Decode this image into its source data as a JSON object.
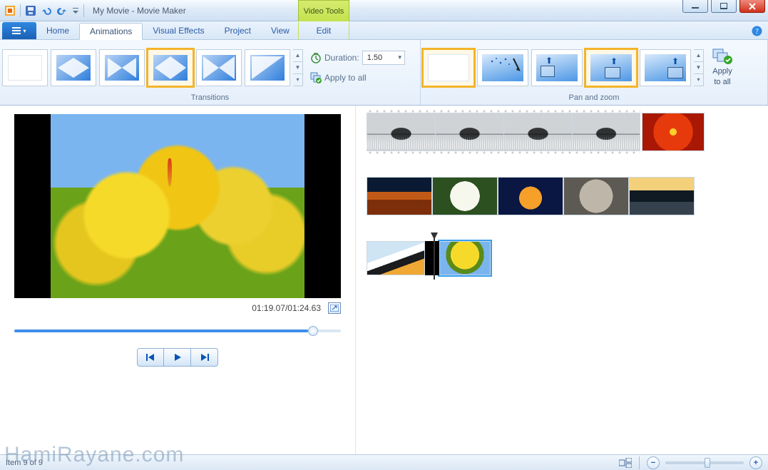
{
  "window": {
    "title": "My Movie - Movie Maker",
    "context_tab_title": "Video Tools"
  },
  "tabs": {
    "file_glyph": "▾",
    "home": "Home",
    "animations": "Animations",
    "visual_effects": "Visual Effects",
    "project": "Project",
    "view": "View",
    "edit": "Edit"
  },
  "ribbon": {
    "transitions": {
      "label": "Transitions",
      "duration_label": "Duration:",
      "duration_value": "1.50",
      "apply_all": "Apply to all"
    },
    "pan_zoom": {
      "label": "Pan and zoom",
      "apply_line1": "Apply",
      "apply_line2": "to all"
    }
  },
  "preview": {
    "time": "01:19.07/01:24.63"
  },
  "status": {
    "item_text": "Item 9 of 9"
  },
  "watermark": "HamiRayane.com"
}
